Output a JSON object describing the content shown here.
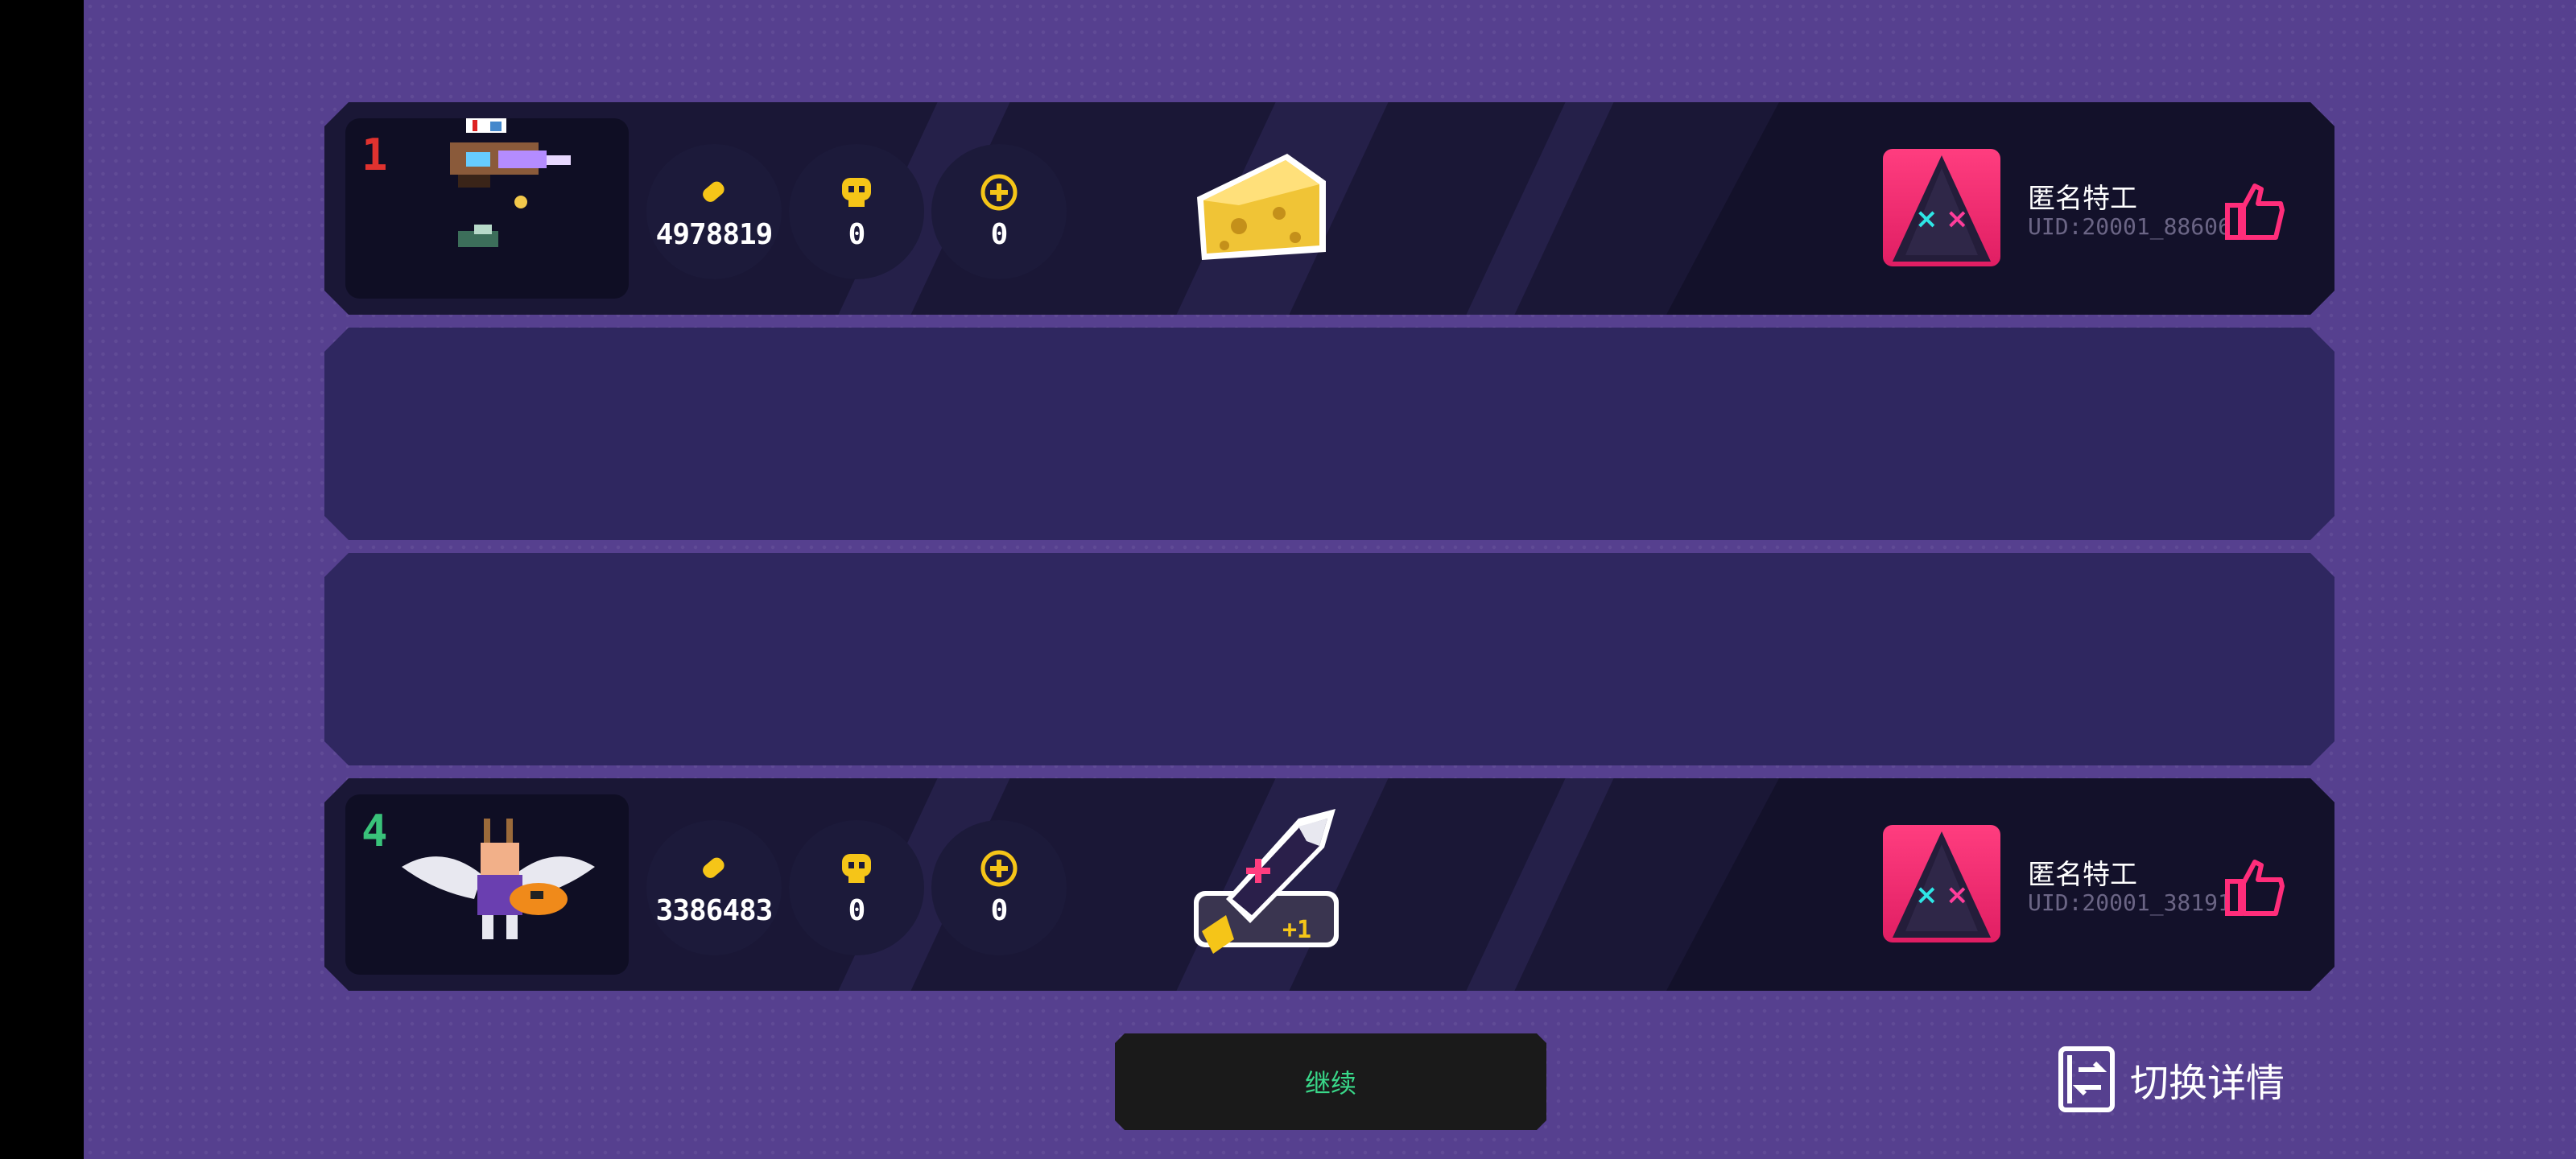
{
  "rows": [
    {
      "rank": "1",
      "rank_color": "#e0322f",
      "stats": {
        "ammo": "4978819",
        "kills": "0",
        "heal": "0"
      },
      "item": "cheese-icon",
      "player": {
        "name": "匿名特工",
        "uid": "UID:20001_88606"
      }
    },
    {
      "rank": "4",
      "rank_color": "#39c27a",
      "stats": {
        "ammo": "3386483",
        "kills": "0",
        "heal": "0"
      },
      "item": "shark-rocket-icon",
      "item_badge": "+1",
      "player": {
        "name": "匿名特工",
        "uid": "UID:20001_38191"
      }
    }
  ],
  "continue_label": "继续",
  "switch_label": "切换详情",
  "colors": {
    "background": "#56408f",
    "row": "#1a1736",
    "empty_row": "#2f2760",
    "accent_pink": "#ff2d7a",
    "stat_yellow": "#f5c518",
    "continue_text": "#39d98a"
  }
}
